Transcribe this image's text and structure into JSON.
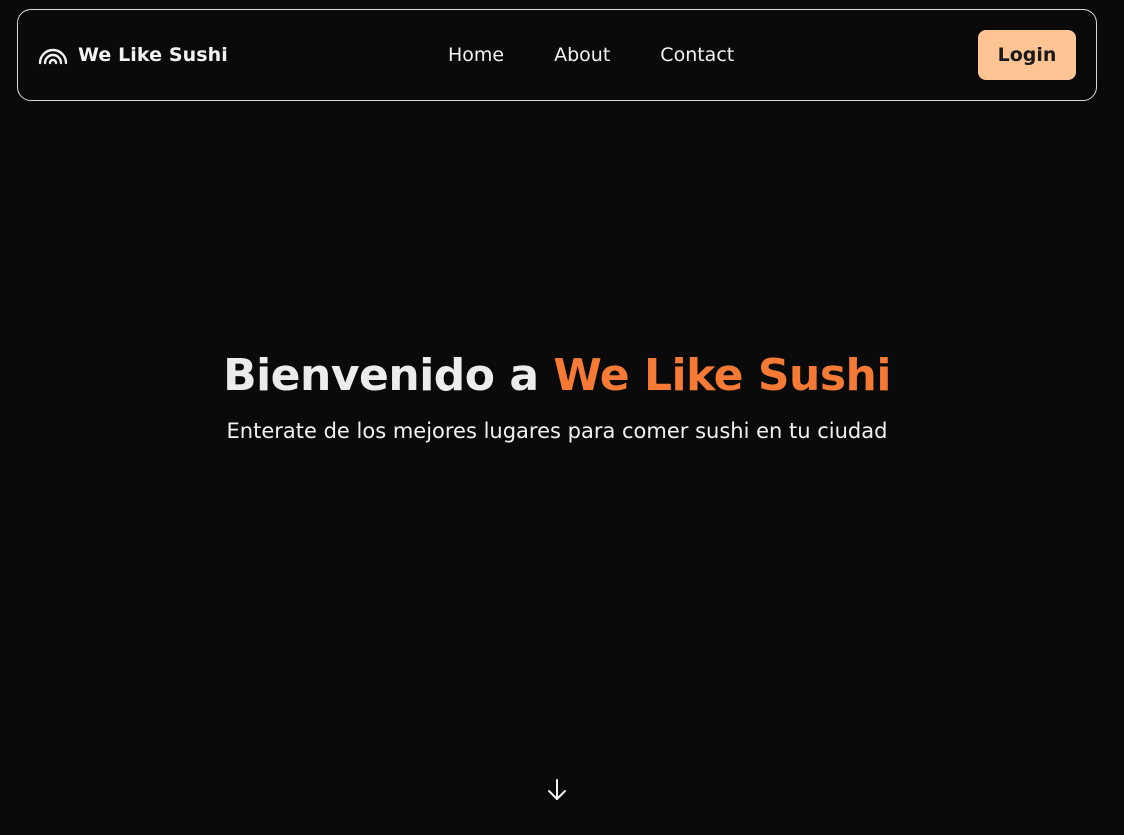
{
  "navbar": {
    "brand": {
      "name": "We Like Sushi",
      "icon": "rainbow-icon"
    },
    "links": [
      {
        "label": "Home"
      },
      {
        "label": "About"
      },
      {
        "label": "Contact"
      }
    ],
    "login_label": "Login"
  },
  "hero": {
    "title_prefix": "Bienvenido a ",
    "title_highlight": "We Like Sushi",
    "subtitle": "Enterate de los mejores lugares para comer sushi en tu ciudad"
  },
  "scroll_icon": "arrow-down-icon",
  "colors": {
    "background": "#0a0a0a",
    "accent": "#f47a35",
    "button": "#ffc494",
    "text": "#f2f2f2",
    "border": "#d9d9d9"
  }
}
